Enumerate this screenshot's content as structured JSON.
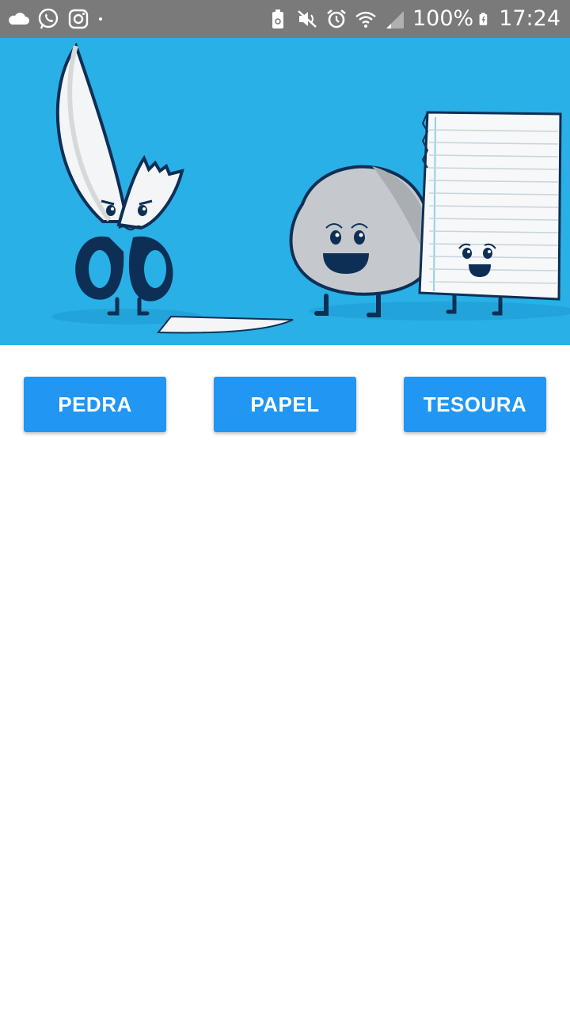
{
  "status_bar": {
    "battery_percent": "100%",
    "time": "17:24",
    "left_icons": [
      "cloud-icon",
      "whatsapp-icon",
      "instagram-icon",
      "dot-icon"
    ],
    "right_icons": [
      "battery-saver-icon",
      "mute-icon",
      "alarm-icon",
      "wifi-icon",
      "signal-icon",
      "battery-charging-icon"
    ]
  },
  "hero": {
    "image": "rock-paper-scissors-illustration",
    "background_color": "#29b0e6"
  },
  "choices": {
    "rock_label": "PEDRA",
    "paper_label": "PAPEL",
    "scissors_label": "TESOURA",
    "button_color": "#2196f3"
  }
}
